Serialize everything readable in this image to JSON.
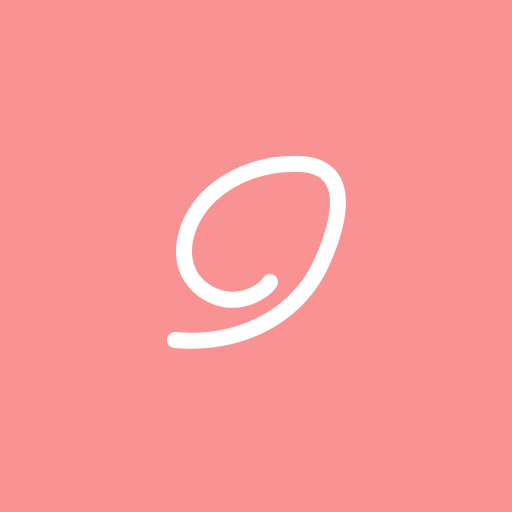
{
  "app_icon": {
    "background_color": "#f99292",
    "logo": {
      "icon": "script-letter-g-logo-icon",
      "stroke_color": "#ffffff"
    }
  }
}
